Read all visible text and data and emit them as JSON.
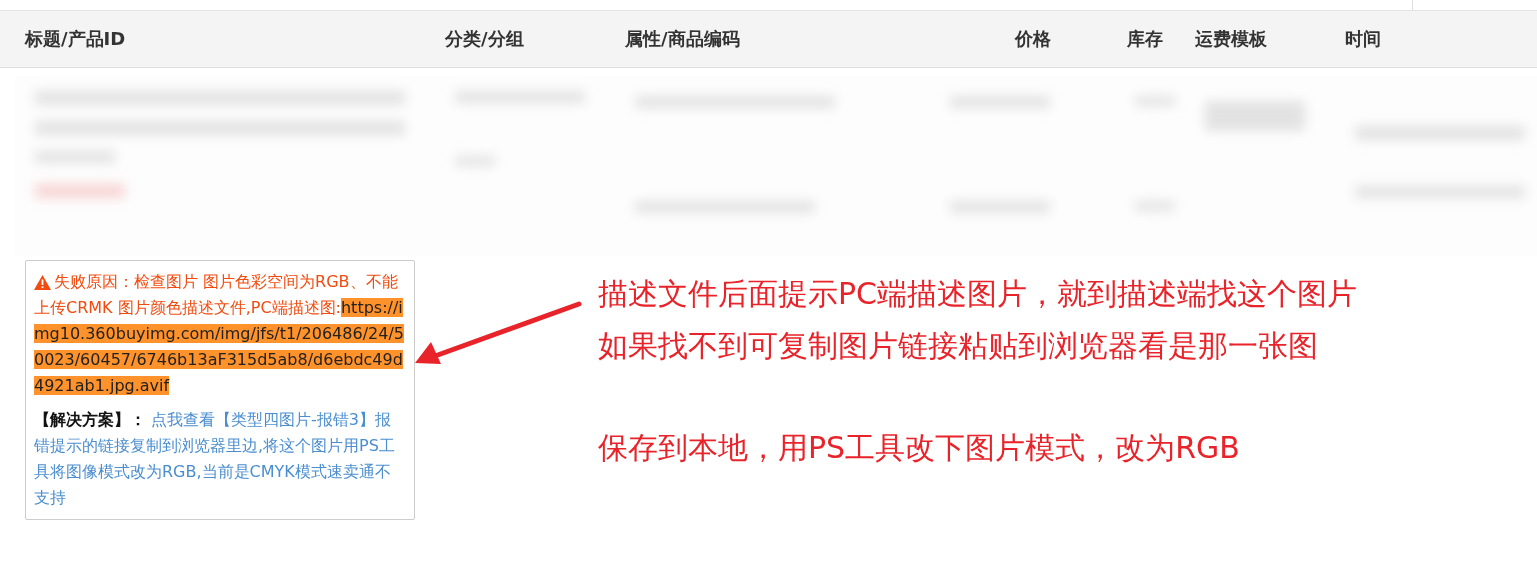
{
  "table": {
    "columns": [
      {
        "label": "标题/产品ID"
      },
      {
        "label": "分类/分组"
      },
      {
        "label": "属性/商品编码"
      },
      {
        "label": "价格"
      },
      {
        "label": "库存"
      },
      {
        "label": "运费模板"
      },
      {
        "label": "时间"
      }
    ]
  },
  "error": {
    "reason": "失败原因：检查图片 图片色彩空间为RGB、不能上传CRMK 图片颜色描述文件,PC端描述图:",
    "url": "https://img10.360buyimg.com/img/jfs/t1/206486/24/50023/60457/6746b13aF315d5ab8/d6ebdc49d4921ab1.jpg.avif",
    "solution": "**【解决方案】：** 点我查看【类型四图片-报错3】报错提示的链接复制到浏览器里边,将这个图片用PS工具将图像模式改为RGB,当前是CMYK模式速卖通不支持"
  },
  "annotation": {
    "lines": [
      {
        "text": "描述文件后面提示PC端描述图片，就到描述端找这个图片"
      },
      {
        "text": "如果找不到可复制图片链接粘贴到浏览器看是那一张图"
      },
      {
        "text": "保存到本地，用PS工具改下图片模式，改为RGB"
      }
    ]
  }
}
